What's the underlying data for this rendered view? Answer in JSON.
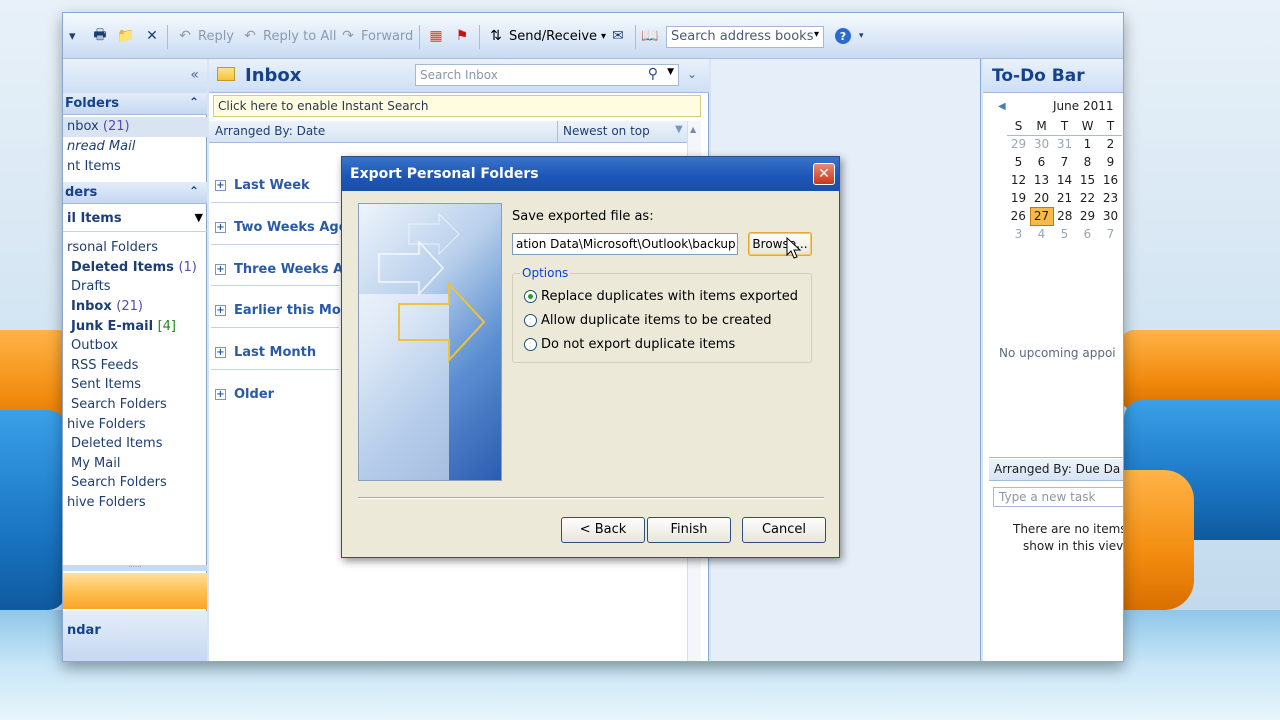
{
  "toolbar": {
    "reply": "Reply",
    "reply_all": "Reply to All",
    "forward": "Forward",
    "send_receive": "Send/Receive",
    "search_address_books": "Search address books"
  },
  "nav": {
    "collapse_glyph": "«",
    "favorite_header": "Folders",
    "favorites": [
      {
        "label": "nbox",
        "count": "(21)"
      },
      {
        "label": "nread Mail",
        "count": ""
      },
      {
        "label": "nt Items",
        "count": ""
      }
    ],
    "mail_header": "ders",
    "mail_items": "il Items",
    "folders": [
      {
        "label": "rsonal Folders",
        "count": "",
        "bold": false
      },
      {
        "label": "Deleted Items",
        "count": "(1)",
        "bold": true
      },
      {
        "label": "Drafts",
        "count": "",
        "bold": false
      },
      {
        "label": "Inbox",
        "count": "(21)",
        "bold": true
      },
      {
        "label": "Junk E-mail",
        "count": "[4]",
        "bold": true
      },
      {
        "label": "Outbox",
        "count": "",
        "bold": false
      },
      {
        "label": "RSS Feeds",
        "count": "",
        "bold": false
      },
      {
        "label": "Sent Items",
        "count": "",
        "bold": false
      },
      {
        "label": "Search Folders",
        "count": "",
        "bold": false
      },
      {
        "label": "hive Folders",
        "count": "",
        "bold": false
      },
      {
        "label": "Deleted Items",
        "count": "",
        "bold": false
      },
      {
        "label": "My Mail",
        "count": "",
        "bold": false
      },
      {
        "label": "Search Folders",
        "count": "",
        "bold": false
      },
      {
        "label": "hive Folders",
        "count": "",
        "bold": false
      }
    ],
    "calendar_button": "ndar"
  },
  "inbox": {
    "title": "Inbox",
    "search_placeholder": "Search Inbox",
    "instant_search": "Click here to enable Instant Search",
    "arranged_by": "Arranged By: Date",
    "sort_order": "Newest on top",
    "groups": [
      "Last Week",
      "Two Weeks Ago",
      "Three Weeks Ago",
      "Earlier this Month",
      "Last Month",
      "Older"
    ]
  },
  "todo": {
    "title": "To-Do Bar",
    "month": "June 2011",
    "weekdays": [
      "S",
      "M",
      "T",
      "W",
      "T"
    ],
    "weeks": [
      [
        "29",
        "30",
        "31",
        "1",
        "2"
      ],
      [
        "5",
        "6",
        "7",
        "8",
        "9"
      ],
      [
        "12",
        "13",
        "14",
        "15",
        "16"
      ],
      [
        "19",
        "20",
        "21",
        "22",
        "23"
      ],
      [
        "26",
        "27",
        "28",
        "29",
        "30"
      ],
      [
        "3",
        "4",
        "5",
        "6",
        "7"
      ]
    ],
    "today": "27",
    "no_appointments": "No upcoming appoi",
    "arranged_by": "Arranged By: Due Da",
    "new_task_placeholder": "Type a new task",
    "no_items_line1": "There are no items",
    "no_items_line2": "show in this viev"
  },
  "dialog": {
    "title": "Export Personal Folders",
    "close": "✕",
    "save_label": "Save exported file as:",
    "file_path": "ation Data\\Microsoft\\Outlook\\backup.pst",
    "browse": "Browse...",
    "options_label": "Options",
    "options": [
      "Replace duplicates with items exported",
      "Allow duplicate items to be created",
      "Do not export duplicate items"
    ],
    "selected_option": 0,
    "back": "< Back",
    "finish": "Finish",
    "cancel": "Cancel"
  }
}
